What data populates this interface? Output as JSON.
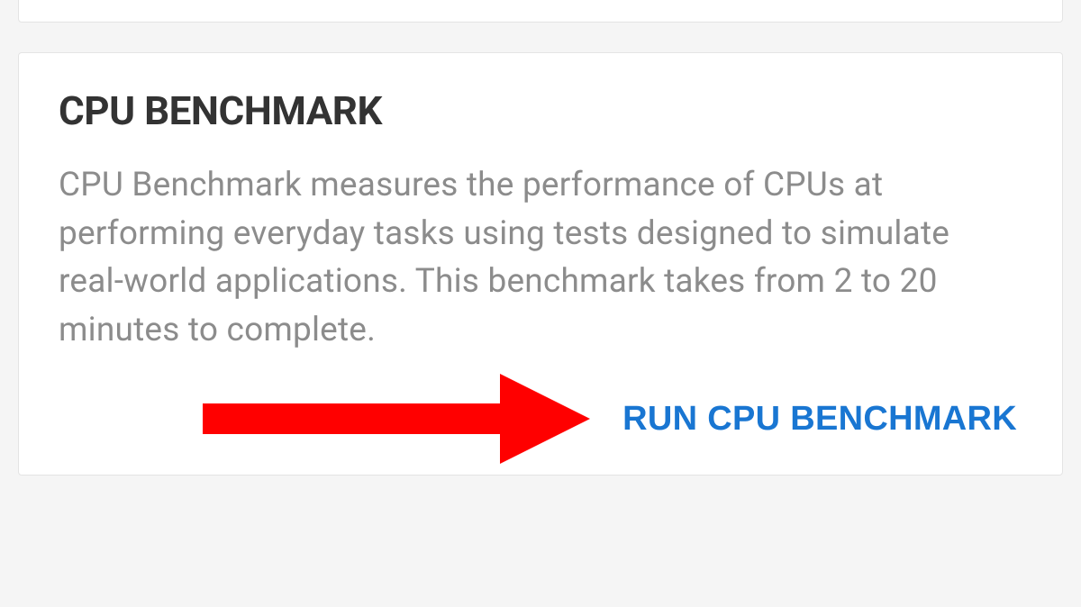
{
  "benchmark_card": {
    "title": "CPU BENCHMARK",
    "description": "CPU Benchmark measures the performance of CPUs at performing everyday tasks using tests designed to simulate real-world applications. This benchmark takes from 2 to 20 minutes to complete.",
    "run_button_label": "RUN CPU BENCHMARK"
  },
  "annotation": {
    "arrow_color": "#ff0000"
  }
}
